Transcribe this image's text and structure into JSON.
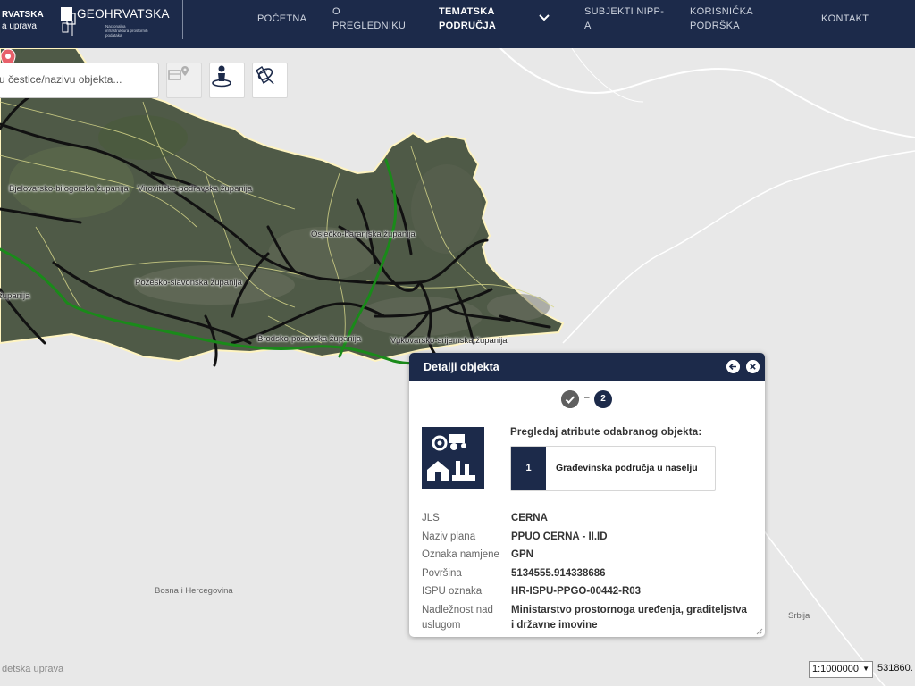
{
  "header": {
    "brand_left_line1": "RVATSKA",
    "brand_left_line2": "a uprava",
    "logo_title": "GEOHRVATSKA",
    "logo_subtitle": "Nacionalna infrastruktura prostornih podataka",
    "nav": [
      {
        "label": "POČETNA"
      },
      {
        "label": "O PREGLEDNIKU"
      },
      {
        "label": "TEMATSKA PODRUČJA"
      },
      {
        "label": "SUBJEKTI NIPP-A"
      },
      {
        "label": "KORISNIČKA PODRŠKA"
      },
      {
        "label": "KONTAKT"
      }
    ]
  },
  "search": {
    "placeholder": "u čestice/nazivu objekta..."
  },
  "toolbar": {
    "icons": [
      "parcel-location-icon",
      "person-location-icon",
      "satellite-icon"
    ]
  },
  "map": {
    "region_labels": [
      "Bjelovarsko-bilogorska županija",
      "Virovitičko-podravska županija",
      "Osječko-baranjska županija",
      "Požeško-slavonska županija",
      "Brodsko-posavska županija",
      "Vukovarsko-srijemska županija",
      "županija"
    ],
    "country_labels": [
      "Bosna i Hercegovina",
      "Srbija"
    ],
    "attribution": "detska uprava",
    "scale": "1:1000000",
    "coordinate": "531860."
  },
  "popup": {
    "title": "Detalji objekta",
    "step_dash": "–",
    "step_current": "2",
    "prompt": "Pregledaj atribute odabranog objekta:",
    "layer_index": "1",
    "layer_name": "Građevinska područja u naselju",
    "attributes": [
      {
        "label": "JLS",
        "value": "CERNA"
      },
      {
        "label": "Naziv plana",
        "value": "PPUO CERNA - II.ID"
      },
      {
        "label": "Oznaka namjene",
        "value": "GPN"
      },
      {
        "label": "Površina",
        "value": "5134555.914338686"
      },
      {
        "label": "ISPU oznaka",
        "value": "HR-ISPU-PPGO-00442-R03"
      },
      {
        "label": "Nadležnost nad uslugom",
        "value": "Ministarstvo prostornoga uređenja, graditeljstva i državne imovine"
      }
    ]
  },
  "colors": {
    "navy": "#1c2a4a",
    "marker": "#e8606a",
    "highway": "#1a8a1a"
  }
}
